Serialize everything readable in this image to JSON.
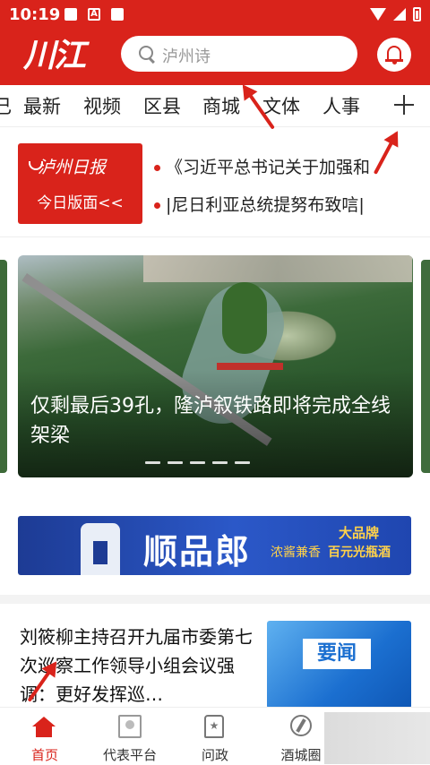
{
  "status": {
    "time": "10:19",
    "notif_badge": "A"
  },
  "header": {
    "logo_text": "川江",
    "search_placeholder": "泸州诗"
  },
  "tabs": [
    "最新",
    "视频",
    "区县",
    "商城",
    "文体",
    "人事"
  ],
  "tab_partial_left": "己",
  "paper": {
    "name": "泸州日报",
    "sub": "今日版面<<"
  },
  "headlines": [
    "《习近平总书记关于加强和",
    "|尼日利亚总统提努布致唁|"
  ],
  "carousel": {
    "caption": "仅剩最后39孔，隆泸叙铁路即将完成全线架梁",
    "slides": 5
  },
  "ad": {
    "brand": "顺品郎",
    "tag1": "大品牌",
    "tag2a": "浓酱兼香",
    "tag2b": "百元光瓶酒"
  },
  "news": {
    "title": "刘筱柳主持召开九届市委第七次巡察工作领导小组会议强调：更好发挥巡…",
    "thumb_label": "要闻"
  },
  "bottom_nav": [
    {
      "label": "首页",
      "icon": "home-icon",
      "active": true
    },
    {
      "label": "代表平台",
      "icon": "representative-icon",
      "active": false
    },
    {
      "label": "问政",
      "icon": "inquiry-icon",
      "active": false
    },
    {
      "label": "酒城圈",
      "icon": "wine-city-icon",
      "active": false
    }
  ],
  "colors": {
    "brand_red": "#d9231b",
    "ad_blue": "#1d3b94",
    "news_thumb_blue": "#1b6fd0"
  }
}
